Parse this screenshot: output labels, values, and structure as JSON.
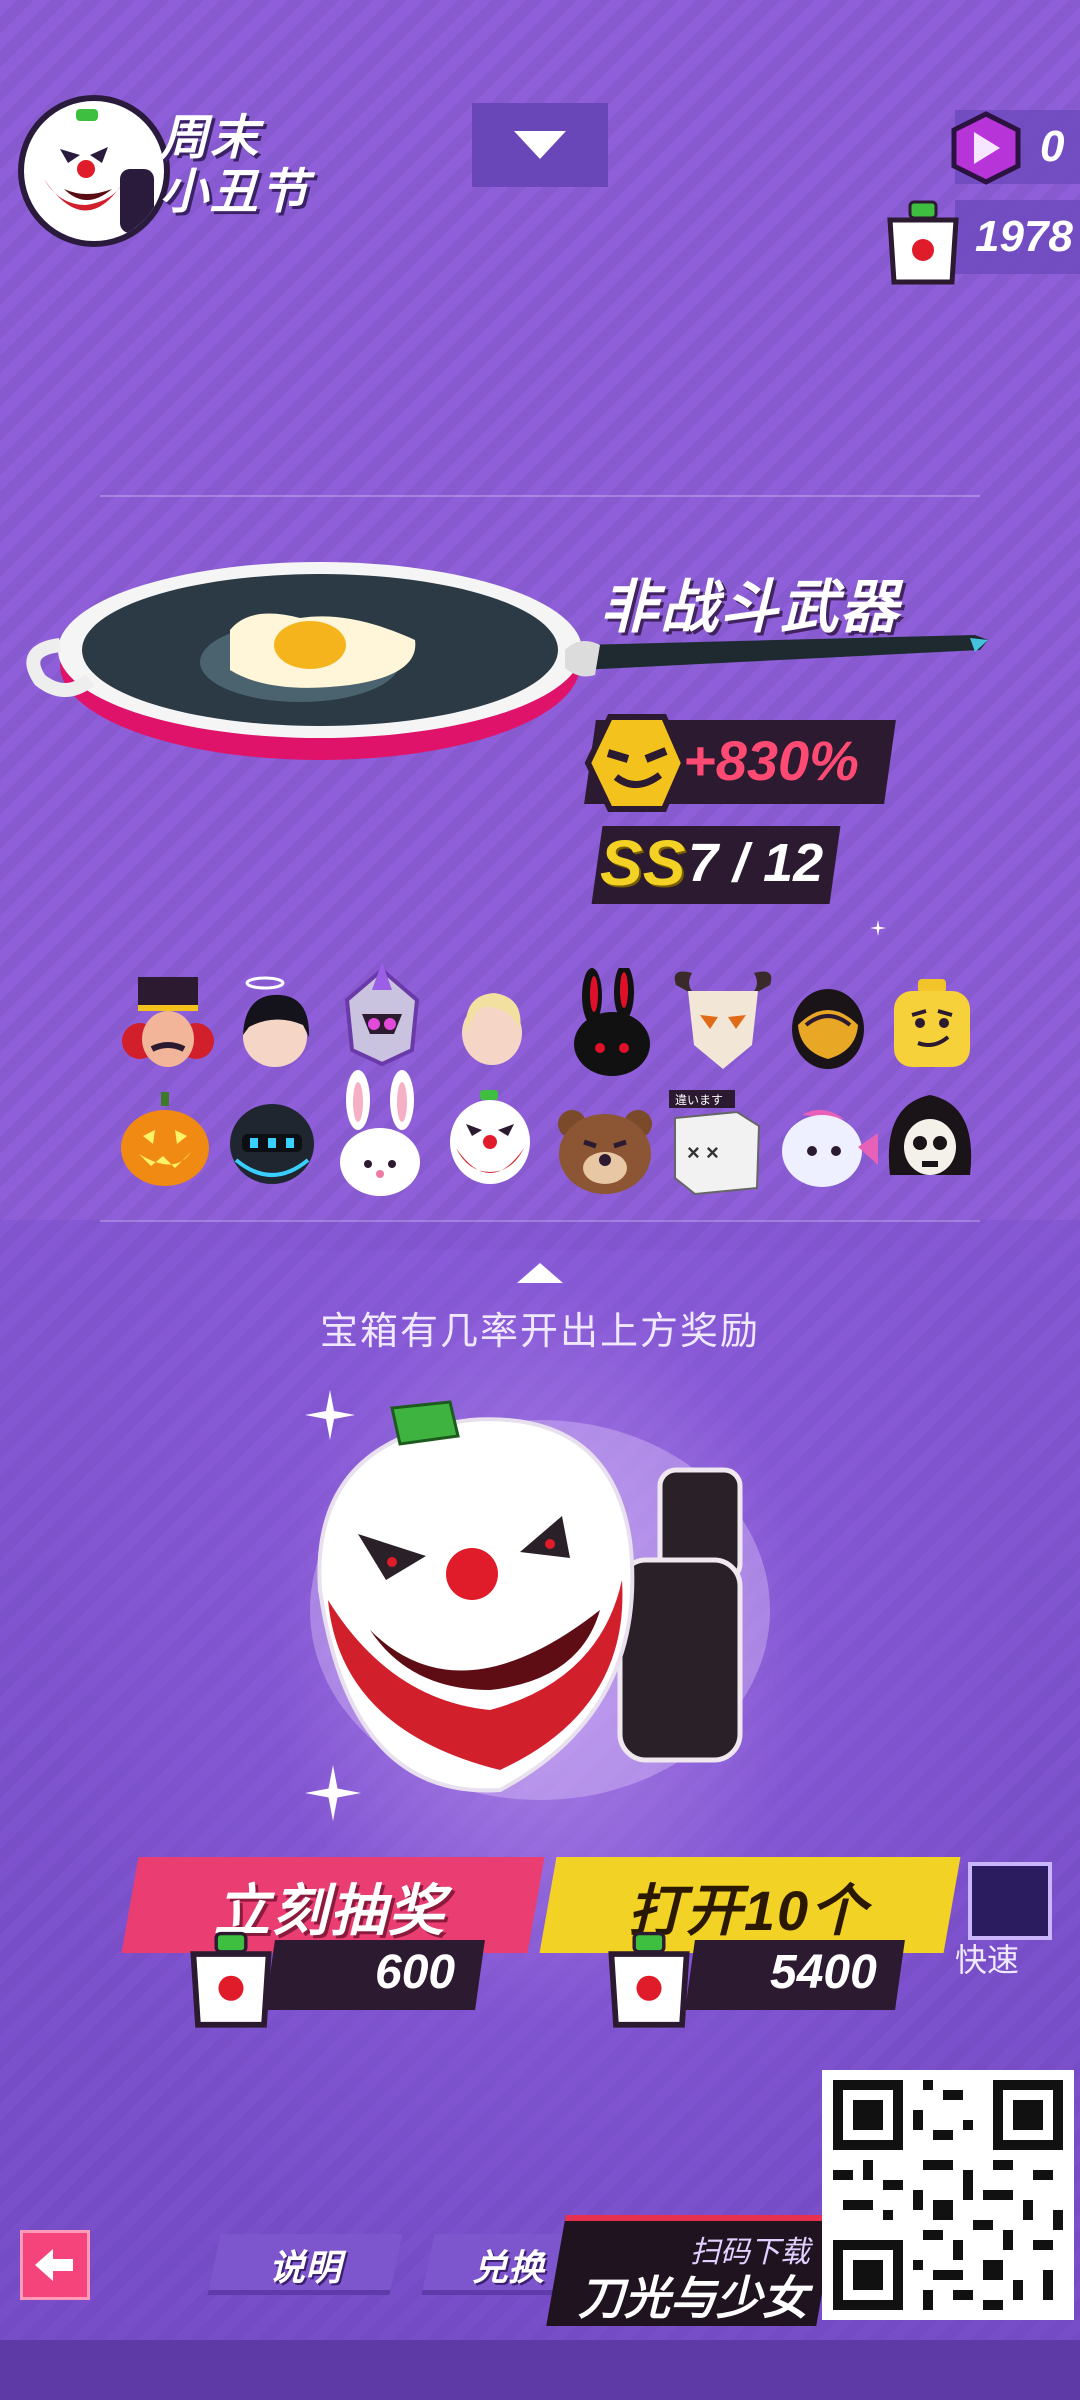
{
  "header": {
    "event_title_line1": "周末",
    "event_title_line2": "小丑节",
    "gems": "0",
    "chests": "1978"
  },
  "weapon": {
    "title": "非战斗武器",
    "bonus": "+830%",
    "grade": "SS",
    "progress": "7 / 12"
  },
  "rewards": {
    "items": [
      {
        "icon": "nutcracker-head-icon"
      },
      {
        "icon": "halo-black-hair-head-icon"
      },
      {
        "icon": "purple-mecha-helmet-icon"
      },
      {
        "icon": "blonde-hair-head-icon"
      },
      {
        "icon": "black-bunny-head-icon"
      },
      {
        "icon": "skull-goat-head-icon"
      },
      {
        "icon": "golden-visor-helmet-icon"
      },
      {
        "icon": "lego-yellow-head-icon"
      },
      {
        "icon": "pumpkin-head-icon"
      },
      {
        "icon": "cyber-knight-helmet-icon"
      },
      {
        "icon": "white-bunny-head-icon"
      },
      {
        "icon": "clown-head-icon"
      },
      {
        "icon": "bear-head-icon"
      },
      {
        "icon": "box-head-icon"
      },
      {
        "icon": "fish-head-icon"
      },
      {
        "icon": "reaper-hood-icon"
      }
    ],
    "box_tag": "違います",
    "hint": "宝箱有几率开出上方奖励"
  },
  "actions": {
    "draw_label": "立刻抽奖",
    "draw_price": "600",
    "open10_label": "打开10个",
    "open10_price": "5400",
    "quick_label": "快速"
  },
  "footer": {
    "info_label": "说明",
    "exchange_label": "兑换",
    "download_small": "扫码下载",
    "download_big": "刀光与少女"
  },
  "colors": {
    "background": "#8e5fd8",
    "draw_button": "#ea3e72",
    "open_button": "#f2d325",
    "bonus_text": "#ff4b74",
    "grade_text": "#f4d225"
  }
}
